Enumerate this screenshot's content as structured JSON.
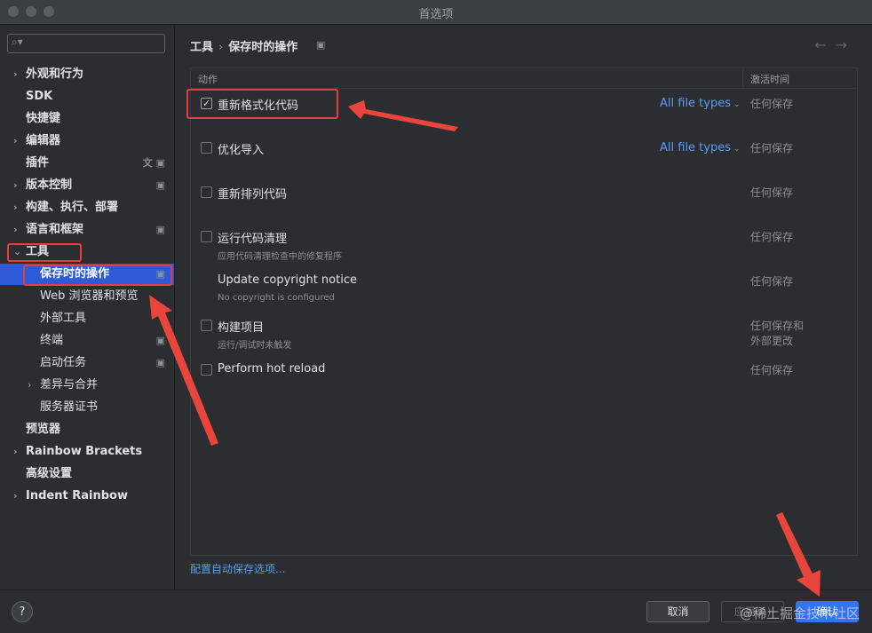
{
  "window": {
    "title": "首选项"
  },
  "sidebar": {
    "search_placeholder": "",
    "items": [
      {
        "label": "外观和行为",
        "chevron": "›"
      },
      {
        "label": "SDK",
        "chevron": ""
      },
      {
        "label": "快捷键",
        "chevron": ""
      },
      {
        "label": "编辑器",
        "chevron": "›"
      },
      {
        "label": "插件",
        "chevron": ""
      },
      {
        "label": "版本控制",
        "chevron": "›"
      },
      {
        "label": "构建、执行、部署",
        "chevron": "›"
      },
      {
        "label": "语言和框架",
        "chevron": "›"
      },
      {
        "label": "工具",
        "chevron": "⌄"
      },
      {
        "label": "保存时的操作",
        "chevron": ""
      },
      {
        "label": "Web 浏览器和预览",
        "chevron": ""
      },
      {
        "label": "外部工具",
        "chevron": ""
      },
      {
        "label": "终端",
        "chevron": ""
      },
      {
        "label": "启动任务",
        "chevron": ""
      },
      {
        "label": "差异与合并",
        "chevron": "›"
      },
      {
        "label": "服务器证书",
        "chevron": ""
      },
      {
        "label": "预览器",
        "chevron": ""
      },
      {
        "label": "Rainbow Brackets",
        "chevron": "›"
      },
      {
        "label": "高级设置",
        "chevron": ""
      },
      {
        "label": "Indent Rainbow",
        "chevron": "›"
      }
    ],
    "selected_index": 9
  },
  "header": {
    "breadcrumb_parent": "工具",
    "separator": "›",
    "breadcrumb_current": "保存时的操作"
  },
  "table": {
    "col_action": "动作",
    "col_trigger": "激活时间",
    "rows": [
      {
        "name": "重新格式化代码",
        "sub": "",
        "checked": true,
        "has_checkbox": true,
        "file_types": "All file types",
        "trigger": "任何保存"
      },
      {
        "name": "优化导入",
        "sub": "",
        "checked": false,
        "has_checkbox": true,
        "file_types": "All file types",
        "trigger": "任何保存"
      },
      {
        "name": "重新排列代码",
        "sub": "",
        "checked": false,
        "has_checkbox": true,
        "file_types": "",
        "trigger": "任何保存"
      },
      {
        "name": "运行代码清理",
        "sub": "应用代码清理检查中的修复程序",
        "checked": false,
        "has_checkbox": true,
        "file_types": "",
        "trigger": "任何保存"
      },
      {
        "name": "Update copyright notice",
        "sub": "No copyright is configured",
        "checked": false,
        "has_checkbox": false,
        "file_types": "",
        "trigger": "任何保存"
      },
      {
        "name": "构建项目",
        "sub": "运行/调试时未触发",
        "checked": false,
        "has_checkbox": true,
        "file_types": "",
        "trigger": "任何保存和\n外部更改"
      },
      {
        "name": "Perform hot reload",
        "sub": "",
        "checked": false,
        "has_checkbox": true,
        "file_types": "",
        "trigger": "任何保存"
      }
    ]
  },
  "footer_link": "配置自动保存选项...",
  "buttons": {
    "help": "?",
    "cancel": "取消",
    "apply": "应用(A)",
    "ok": "确认"
  },
  "watermark": "@稀土掘金技术社区",
  "colors": {
    "accent": "#3574f0",
    "selection": "#2e5bd5",
    "link": "#589df6",
    "annotation": "#e53e3e"
  }
}
